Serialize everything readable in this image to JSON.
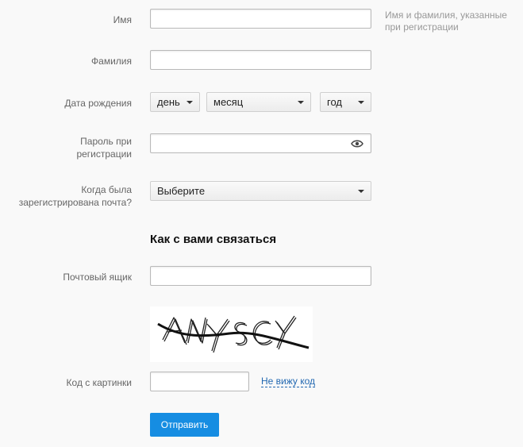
{
  "form": {
    "first_name": {
      "label": "Имя",
      "value": "",
      "hint": "Имя и фамилия, указанные при регистрации"
    },
    "last_name": {
      "label": "Фамилия",
      "value": ""
    },
    "birth_date": {
      "label": "Дата рождения",
      "day": "день",
      "month": "месяц",
      "year": "год"
    },
    "password": {
      "label_line1": "Пароль при",
      "label_line2": "регистрации",
      "value": "",
      "toggle_icon": "eye-icon"
    },
    "registration_time": {
      "label_line1": "Когда была",
      "label_line2": "зарегистрирована почта?",
      "selected": "Выберите"
    },
    "contact_section_title": "Как с вами связаться",
    "mailbox": {
      "label": "Почтовый ящик",
      "value": ""
    },
    "captcha": {
      "image": "captcha-image",
      "text": "ANYSCY"
    },
    "captcha_code": {
      "label": "Код с картинки",
      "value": "",
      "refresh_link": "Не вижу код"
    },
    "submit_label": "Отправить"
  },
  "colors": {
    "background": "#f9f9f9",
    "button": "#168de2",
    "link": "#2168b1",
    "label": "#666666",
    "hint": "#999999"
  }
}
